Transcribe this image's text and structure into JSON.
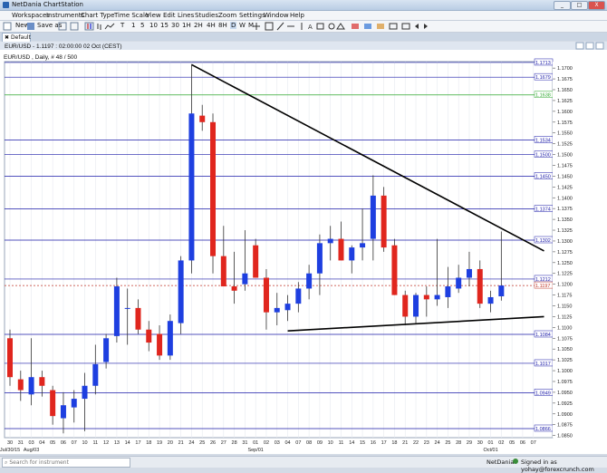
{
  "window": {
    "title": "NetDania ChartStation",
    "min": "_",
    "max": "□",
    "close": "X"
  },
  "menu": [
    "Workspaces",
    "Instruments",
    "Chart Type",
    "Time Scale",
    "View",
    "Edit",
    "Lines",
    "Studies",
    "Zoom",
    "Settings",
    "Window",
    "Help"
  ],
  "toolbar": {
    "new": "New",
    "save_as": "Save as",
    "timeframes": [
      "T",
      "1",
      "5",
      "10",
      "15",
      "30",
      "1H",
      "2H",
      "4H",
      "8H",
      "D",
      "W",
      "M"
    ]
  },
  "tab": {
    "label": "Default"
  },
  "chart": {
    "header": "EUR/USD - 1.1197 : 02:00:00 02 Oct (CEST)",
    "subheader": "EUR/USD , Daily, # 48 / 500",
    "price_ticks": [
      "1.1700",
      "1.1675",
      "1.1650",
      "1.1625",
      "1.1600",
      "1.1575",
      "1.1550",
      "1.1525",
      "1.1500",
      "1.1475",
      "1.1450",
      "1.1425",
      "1.1400",
      "1.1375",
      "1.1350",
      "1.1325",
      "1.1300",
      "1.1275",
      "1.1250",
      "1.1225",
      "1.1200",
      "1.1175",
      "1.1150",
      "1.1125",
      "1.1100",
      "1.1075",
      "1.1050",
      "1.1025",
      "1.1000",
      "1.0975",
      "1.0950",
      "1.0925",
      "1.0900",
      "1.0875",
      "1.0850"
    ],
    "x_ticks": [
      "30",
      "31",
      "03",
      "04",
      "05",
      "06",
      "07",
      "10",
      "11",
      "12",
      "13",
      "14",
      "17",
      "18",
      "19",
      "20",
      "21",
      "24",
      "25",
      "26",
      "27",
      "28",
      "31",
      "01",
      "02",
      "03",
      "04",
      "07",
      "08",
      "09",
      "10",
      "11",
      "14",
      "15",
      "16",
      "17",
      "18",
      "21",
      "22",
      "23",
      "24",
      "25",
      "28",
      "29",
      "30",
      "01",
      "02",
      "05",
      "06",
      "07"
    ],
    "x_month_labels": [
      {
        "idx": 0,
        "text": "Jul/30/15"
      },
      {
        "idx": 2,
        "text": "Aug/03"
      },
      {
        "idx": 23,
        "text": "Sep/01"
      },
      {
        "idx": 45,
        "text": "Oct/01"
      }
    ]
  },
  "chart_data": {
    "type": "candlestick",
    "symbol": "EUR/USD",
    "ylim": [
      1.0845,
      1.1715
    ],
    "levels": [
      {
        "value": 1.1713,
        "label": "1.1713",
        "color": "#1a1aa8"
      },
      {
        "value": 1.1679,
        "label": "1.1679",
        "color": "#1a1aa8"
      },
      {
        "value": 1.1638,
        "label": "1.1638",
        "color": "#2fa82f"
      },
      {
        "value": 1.1534,
        "label": "1.1534",
        "color": "#1a1aa8"
      },
      {
        "value": 1.15,
        "label": "1.1500",
        "color": "#1a1aa8"
      },
      {
        "value": 1.145,
        "label": "1.1450",
        "color": "#1a1aa8"
      },
      {
        "value": 1.1374,
        "label": "1.1374",
        "color": "#1a1aa8"
      },
      {
        "value": 1.1302,
        "label": "1.1302",
        "color": "#1a1aa8"
      },
      {
        "value": 1.1212,
        "label": "1.1212",
        "color": "#1a1aa8"
      },
      {
        "value": 1.1084,
        "label": "1.1084",
        "color": "#1a1aa8"
      },
      {
        "value": 1.1017,
        "label": "1.1017",
        "color": "#1a1aa8"
      },
      {
        "value": 1.0949,
        "label": "1.0949",
        "color": "#1a1aa8"
      },
      {
        "value": 1.0866,
        "label": "1.0866",
        "color": "#1a1aa8"
      }
    ],
    "current": {
      "value": 1.1197,
      "label": "1.1197",
      "color": "#c0392b"
    },
    "trendlines": [
      {
        "from": [
          17,
          1.1708
        ],
        "to": [
          50,
          1.1277
        ]
      },
      {
        "from": [
          26,
          1.1092
        ],
        "to": [
          50,
          1.1125
        ]
      }
    ],
    "candles": [
      {
        "o": 1.1075,
        "h": 1.1095,
        "l": 1.0965,
        "c": 1.0985
      },
      {
        "o": 1.098,
        "h": 1.1,
        "l": 1.093,
        "c": 1.0955
      },
      {
        "o": 1.0945,
        "h": 1.1075,
        "l": 1.092,
        "c": 1.0985
      },
      {
        "o": 1.0985,
        "h": 1.1,
        "l": 1.094,
        "c": 1.0965
      },
      {
        "o": 1.0955,
        "h": 1.0965,
        "l": 1.0875,
        "c": 1.0895
      },
      {
        "o": 1.089,
        "h": 1.095,
        "l": 1.0855,
        "c": 1.092
      },
      {
        "o": 1.0915,
        "h": 1.0955,
        "l": 1.088,
        "c": 1.0935
      },
      {
        "o": 1.0935,
        "h": 1.0995,
        "l": 1.086,
        "c": 1.0965
      },
      {
        "o": 1.0965,
        "h": 1.106,
        "l": 1.0945,
        "c": 1.1015
      },
      {
        "o": 1.102,
        "h": 1.1085,
        "l": 1.1005,
        "c": 1.1075
      },
      {
        "o": 1.108,
        "h": 1.1215,
        "l": 1.1065,
        "c": 1.1195
      },
      {
        "o": 1.1145,
        "h": 1.119,
        "l": 1.106,
        "c": 1.1145
      },
      {
        "o": 1.1145,
        "h": 1.1165,
        "l": 1.1085,
        "c": 1.1095
      },
      {
        "o": 1.1095,
        "h": 1.1115,
        "l": 1.1045,
        "c": 1.1065
      },
      {
        "o": 1.1085,
        "h": 1.1105,
        "l": 1.1025,
        "c": 1.1035
      },
      {
        "o": 1.1035,
        "h": 1.113,
        "l": 1.1025,
        "c": 1.1115
      },
      {
        "o": 1.111,
        "h": 1.1265,
        "l": 1.1085,
        "c": 1.1255
      },
      {
        "o": 1.1255,
        "h": 1.1708,
        "l": 1.1225,
        "c": 1.1595
      },
      {
        "o": 1.159,
        "h": 1.1615,
        "l": 1.1555,
        "c": 1.1575
      },
      {
        "o": 1.1575,
        "h": 1.1595,
        "l": 1.1225,
        "c": 1.1265
      },
      {
        "o": 1.1265,
        "h": 1.1335,
        "l": 1.1205,
        "c": 1.1195
      },
      {
        "o": 1.1195,
        "h": 1.1275,
        "l": 1.1155,
        "c": 1.1185
      },
      {
        "o": 1.12,
        "h": 1.1325,
        "l": 1.1185,
        "c": 1.1225
      },
      {
        "o": 1.129,
        "h": 1.1305,
        "l": 1.1215,
        "c": 1.1215
      },
      {
        "o": 1.1215,
        "h": 1.1235,
        "l": 1.1095,
        "c": 1.1135
      },
      {
        "o": 1.1135,
        "h": 1.118,
        "l": 1.1105,
        "c": 1.1145
      },
      {
        "o": 1.114,
        "h": 1.1175,
        "l": 1.1115,
        "c": 1.1155
      },
      {
        "o": 1.1155,
        "h": 1.1205,
        "l": 1.1135,
        "c": 1.119
      },
      {
        "o": 1.119,
        "h": 1.1245,
        "l": 1.1165,
        "c": 1.1225
      },
      {
        "o": 1.1225,
        "h": 1.1315,
        "l": 1.1175,
        "c": 1.1295
      },
      {
        "o": 1.1295,
        "h": 1.1335,
        "l": 1.1255,
        "c": 1.1305
      },
      {
        "o": 1.1305,
        "h": 1.1345,
        "l": 1.1255,
        "c": 1.1255
      },
      {
        "o": 1.1255,
        "h": 1.129,
        "l": 1.1225,
        "c": 1.1285
      },
      {
        "o": 1.1285,
        "h": 1.1375,
        "l": 1.1255,
        "c": 1.1295
      },
      {
        "o": 1.1305,
        "h": 1.1452,
        "l": 1.1255,
        "c": 1.1405
      },
      {
        "o": 1.1405,
        "h": 1.1425,
        "l": 1.1275,
        "c": 1.1285
      },
      {
        "o": 1.129,
        "h": 1.1305,
        "l": 1.1175,
        "c": 1.1175
      },
      {
        "o": 1.1175,
        "h": 1.1185,
        "l": 1.1105,
        "c": 1.1125
      },
      {
        "o": 1.1125,
        "h": 1.118,
        "l": 1.111,
        "c": 1.1175
      },
      {
        "o": 1.1175,
        "h": 1.1195,
        "l": 1.1125,
        "c": 1.1165
      },
      {
        "o": 1.1165,
        "h": 1.1305,
        "l": 1.115,
        "c": 1.1175
      },
      {
        "o": 1.117,
        "h": 1.124,
        "l": 1.1145,
        "c": 1.1195
      },
      {
        "o": 1.119,
        "h": 1.1245,
        "l": 1.118,
        "c": 1.1215
      },
      {
        "o": 1.1215,
        "h": 1.1275,
        "l": 1.1195,
        "c": 1.1235
      },
      {
        "o": 1.1235,
        "h": 1.1255,
        "l": 1.1145,
        "c": 1.1155
      },
      {
        "o": 1.1155,
        "h": 1.1185,
        "l": 1.1135,
        "c": 1.117
      },
      {
        "o": 1.1172,
        "h": 1.1322,
        "l": 1.1162,
        "c": 1.1197
      }
    ],
    "colors": {
      "up": "#1e3fe0",
      "down": "#e0261e"
    }
  },
  "status": {
    "search_placeholder": "Search for instrument",
    "brand": "NetDania",
    "signed": "Signed in as yohay@forexcrunch.com"
  }
}
